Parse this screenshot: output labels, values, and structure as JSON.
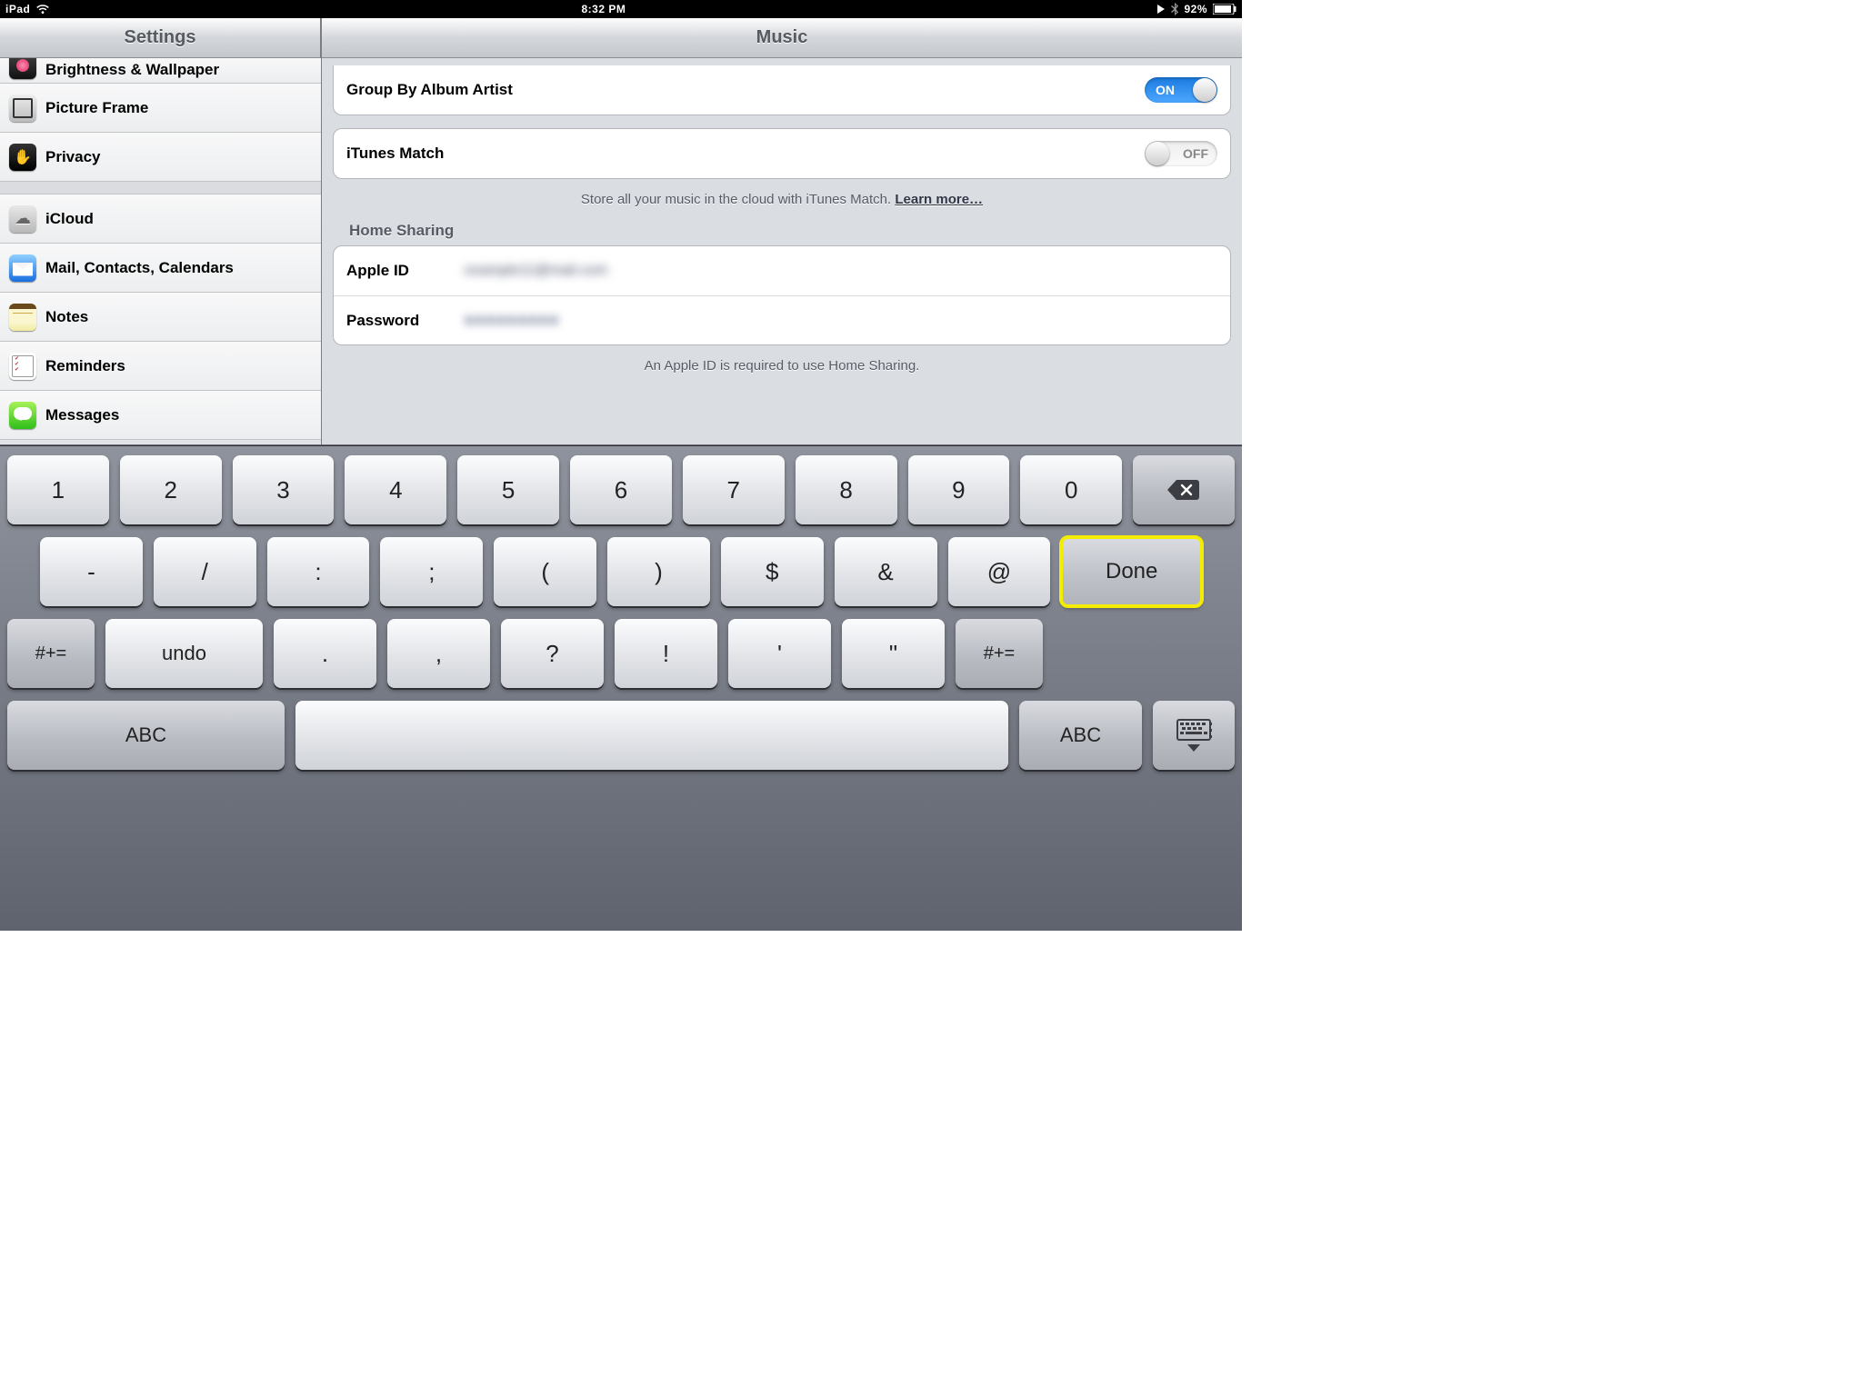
{
  "status": {
    "device": "iPad",
    "time": "8:32 PM",
    "battery": "92%"
  },
  "sidebar": {
    "title": "Settings",
    "items": [
      {
        "label": "Brightness & Wallpaper",
        "name": "brightness"
      },
      {
        "label": "Picture Frame",
        "name": "picture-frame"
      },
      {
        "label": "Privacy",
        "name": "privacy"
      },
      {
        "label": "iCloud",
        "name": "icloud"
      },
      {
        "label": "Mail, Contacts, Calendars",
        "name": "mail"
      },
      {
        "label": "Notes",
        "name": "notes"
      },
      {
        "label": "Reminders",
        "name": "reminders"
      },
      {
        "label": "Messages",
        "name": "messages"
      }
    ]
  },
  "detail": {
    "title": "Music",
    "group_by": {
      "label": "Group By Album Artist",
      "state": "ON"
    },
    "match": {
      "label": "iTunes Match",
      "state": "OFF"
    },
    "match_caption": "Store all your music in the cloud with iTunes Match. ",
    "learn_more": "Learn more…",
    "home_sharing": {
      "header": "Home Sharing",
      "apple_id_label": "Apple ID",
      "apple_id_value": "example11@mail.com",
      "password_label": "Password",
      "password_value": "●●●●●●●●●",
      "footer": "An Apple ID is required to use Home Sharing."
    }
  },
  "keyboard": {
    "r1": [
      "1",
      "2",
      "3",
      "4",
      "5",
      "6",
      "7",
      "8",
      "9",
      "0"
    ],
    "r2": [
      "-",
      "/",
      ":",
      ";",
      "(",
      ")",
      "$",
      "&",
      "@"
    ],
    "done": "Done",
    "r3": [
      "#+=",
      "undo",
      ".",
      ",",
      "?",
      "!",
      "'",
      "\"",
      "#+="
    ],
    "abc": "ABC"
  }
}
